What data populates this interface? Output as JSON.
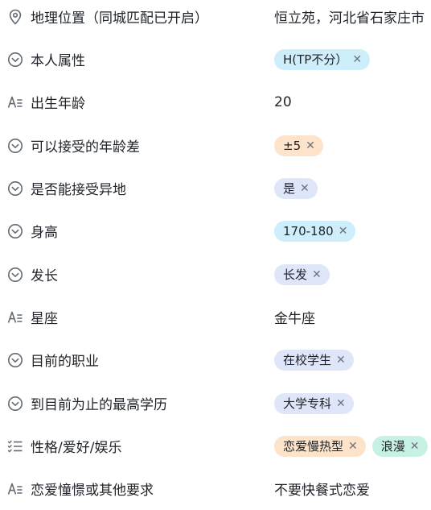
{
  "fields": [
    {
      "label": "地理位置（同城匹配已开启）",
      "icon": "location-pin-icon",
      "text": "恒立苑，河北省石家庄市"
    },
    {
      "label": "本人属性",
      "icon": "chevron-circle-icon",
      "tags": [
        {
          "text": "H(TP不分）",
          "color": "#cdeefa"
        }
      ]
    },
    {
      "label": "出生年龄",
      "icon": "text-field-icon",
      "text": "20"
    },
    {
      "label": "可以接受的年龄差",
      "icon": "chevron-circle-icon",
      "tags": [
        {
          "text": "±5",
          "color": "#fde3c9"
        }
      ]
    },
    {
      "label": "是否能接受异地",
      "icon": "chevron-circle-icon",
      "tags": [
        {
          "text": "是",
          "color": "#e0e6fa"
        }
      ]
    },
    {
      "label": "身高",
      "icon": "chevron-circle-icon",
      "tags": [
        {
          "text": "170-180",
          "color": "#cdeefa"
        }
      ]
    },
    {
      "label": "发长",
      "icon": "chevron-circle-icon",
      "tags": [
        {
          "text": "长发",
          "color": "#e0e6fa"
        }
      ]
    },
    {
      "label": "星座",
      "icon": "text-field-icon",
      "text": "金牛座"
    },
    {
      "label": "目前的职业",
      "icon": "chevron-circle-icon",
      "tags": [
        {
          "text": "在校学生",
          "color": "#e0e6fa"
        }
      ]
    },
    {
      "label": "到目前为止的最高学历",
      "icon": "chevron-circle-icon",
      "tags": [
        {
          "text": "大学专科",
          "color": "#e0e6fa"
        }
      ]
    },
    {
      "label": "性格/爱好/娱乐",
      "icon": "multi-select-icon",
      "tags": [
        {
          "text": "恋爱慢热型",
          "color": "#fde3c9"
        },
        {
          "text": "浪漫",
          "color": "#c8f1e6"
        }
      ]
    },
    {
      "label": "恋爱憧憬或其他要求",
      "icon": "text-field-icon",
      "text": "不要快餐式恋爱"
    }
  ],
  "tag_remove_glyph": "✕"
}
